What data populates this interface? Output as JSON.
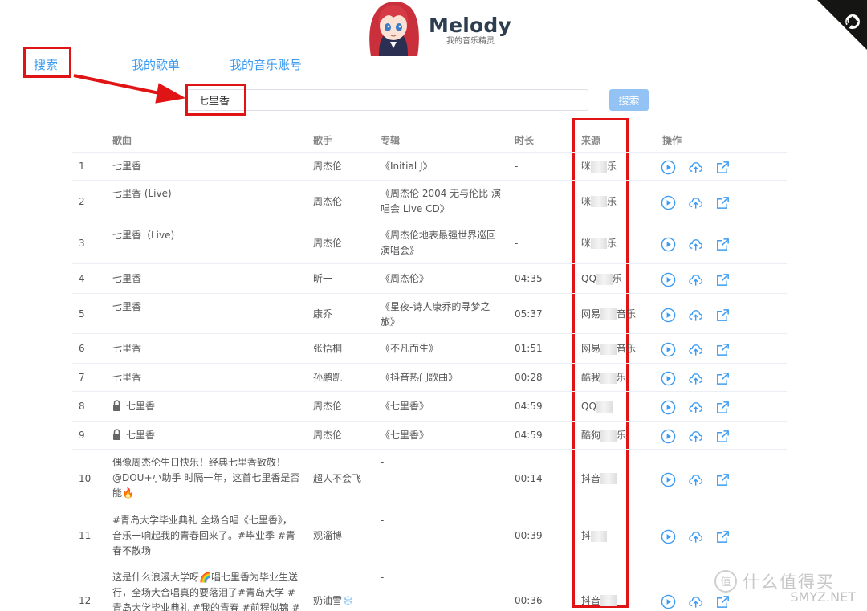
{
  "brand": {
    "title": "Melody",
    "subtitle": "我的音乐精灵"
  },
  "nav": {
    "search": "搜索",
    "playlist": "我的歌单",
    "account": "我的音乐账号"
  },
  "search": {
    "value": "七里香",
    "button": "搜索"
  },
  "table": {
    "headers": {
      "song": "歌曲",
      "artist": "歌手",
      "album": "专辑",
      "duration": "时长",
      "source": "来源",
      "actions": "操作"
    },
    "rows": [
      {
        "idx": "1",
        "title": "七里香",
        "artist": "周杰伦",
        "album": "《Initial J》",
        "duration": "-",
        "src_a": "咪",
        "src_b": "乐"
      },
      {
        "idx": "2",
        "title": "七里香 (Live)",
        "artist": "周杰伦",
        "album": "《周杰伦 2004 无与伦比 演唱会 Live CD》",
        "duration": "-",
        "src_a": "咪",
        "src_b": "乐"
      },
      {
        "idx": "3",
        "title": "七里香（Live)",
        "artist": "周杰伦",
        "album": "《周杰伦地表最强世界巡回演唱会》",
        "duration": "-",
        "src_a": "咪",
        "src_b": "乐"
      },
      {
        "idx": "4",
        "title": "七里香",
        "artist": "昕一",
        "album": "《周杰伦》",
        "duration": "04:35",
        "src_a": "QQ",
        "src_b": "乐"
      },
      {
        "idx": "5",
        "title": "七里香",
        "artist": "康乔",
        "album": "《星夜-诗人康乔的寻梦之旅》",
        "duration": "05:37",
        "src_a": "网易",
        "src_b": "音乐"
      },
      {
        "idx": "6",
        "title": "七里香",
        "artist": "张悟桐",
        "album": "《不凡而生》",
        "duration": "01:51",
        "src_a": "网易",
        "src_b": "音乐"
      },
      {
        "idx": "7",
        "title": "七里香",
        "artist": "孙鹏凯",
        "album": "《抖音热门歌曲》",
        "duration": "00:28",
        "src_a": "酷我",
        "src_b": "乐"
      },
      {
        "idx": "8",
        "title": "七里香",
        "artist": "周杰伦",
        "album": "《七里香》",
        "duration": "04:59",
        "src_a": "QQ",
        "src_b": ""
      },
      {
        "idx": "9",
        "title": "七里香",
        "artist": "周杰伦",
        "album": "《七里香》",
        "duration": "04:59",
        "src_a": "酷狗",
        "src_b": "乐"
      },
      {
        "idx": "10",
        "title": "偶像周杰伦生日快乐！经典七里香致敬！@DOU+小助手 时隔一年，这首七里香是否能🔥",
        "artist": "超人不会飞",
        "album": "-",
        "duration": "00:14",
        "src_a": "抖音",
        "src_b": ""
      },
      {
        "idx": "11",
        "title": "#青岛大学毕业典礼 全场合唱《七里香》，音乐一响起我的青春回来了。#毕业季 #青春不散场",
        "artist": "观淄博",
        "album": "-",
        "duration": "00:39",
        "src_a": "抖",
        "src_b": ""
      },
      {
        "idx": "12",
        "title": "这是什么浪漫大学呀🌈唱七里香为毕业生送行，全场大合唱真的要落泪了#青岛大学 #青岛大学毕业典礼 #我的青春 #前程似锦 #毕业",
        "artist": "奶油雪❄️",
        "album": "-",
        "duration": "00:36",
        "src_a": "抖音",
        "src_b": ""
      }
    ]
  },
  "watermark": {
    "text": "什么值得买",
    "url": "SMYZ.NET"
  },
  "colors": {
    "link": "#3d9cf2",
    "highlight_box": "#e01414",
    "button": "#93c3f5"
  },
  "icons": [
    "github-corner-icon",
    "anime-avatar-icon",
    "play-icon",
    "upload-icon",
    "external-link-icon",
    "lock-icon"
  ]
}
